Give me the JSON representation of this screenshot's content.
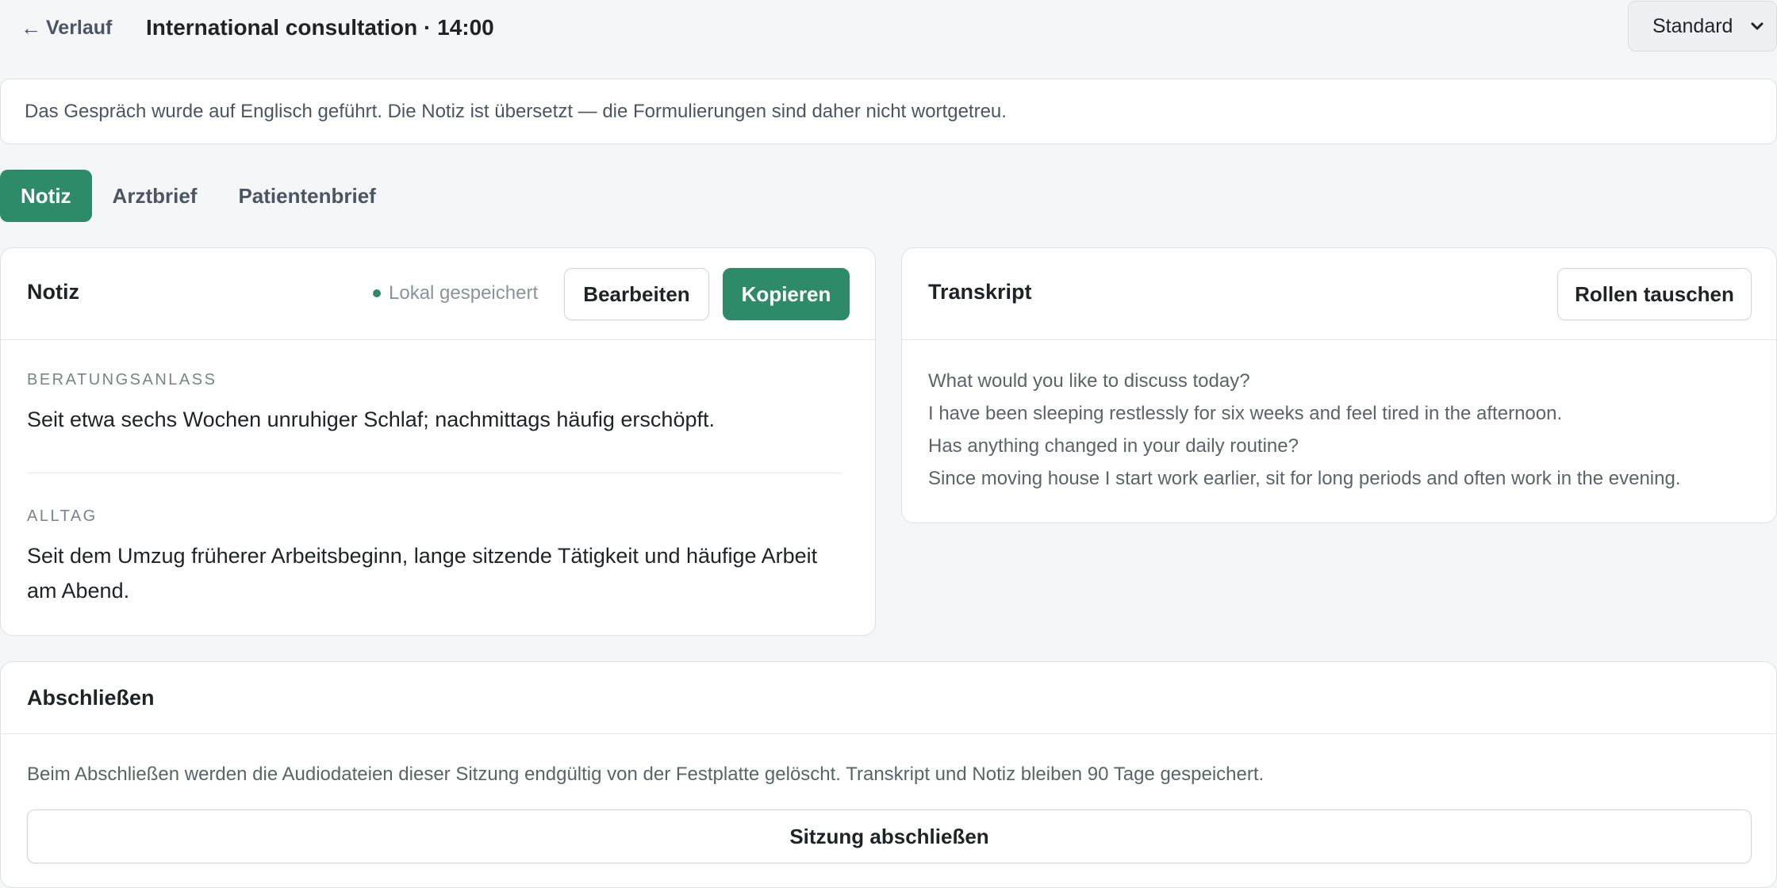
{
  "header": {
    "back_label": "Verlauf",
    "session_title": "International consultation · 14:00",
    "mode_selected": "Standard"
  },
  "banner": {
    "text": "Das Gespräch wurde auf Englisch geführt. Die Notiz ist übersetzt — die Formulierungen sind daher nicht wortgetreu."
  },
  "tabs": [
    {
      "label": "Notiz",
      "active": true
    },
    {
      "label": "Arztbrief",
      "active": false
    },
    {
      "label": "Patientenbrief",
      "active": false
    }
  ],
  "note_card": {
    "title": "Notiz",
    "saved_status": "Lokal gespeichert",
    "edit_label": "Bearbeiten",
    "copy_label": "Kopieren",
    "sections": [
      {
        "label": "BERATUNGSANLASS",
        "text": "Seit etwa sechs Wochen unruhiger Schlaf; nachmittags häufig erschöpft."
      },
      {
        "label": "ALLTAG",
        "text": "Seit dem Umzug früherer Arbeitsbeginn, lange sitzende Tätigkeit und häufige Arbeit am Abend."
      }
    ]
  },
  "transcript_card": {
    "title": "Transkript",
    "swap_roles_label": "Rollen tauschen",
    "lines": [
      "What would you like to discuss today?",
      "I have been sleeping restlessly for six weeks and feel tired in the afternoon.",
      "Has anything changed in your daily routine?",
      "Since moving house I start work earlier, sit for long periods and often work in the evening."
    ]
  },
  "finish_card": {
    "title": "Abschließen",
    "text": "Beim Abschließen werden die Audiodateien dieser Sitzung endgültig von der Festplatte gelöscht. Transkript und Notiz bleiben 90 Tage gespeichert.",
    "button_label": "Sitzung abschließen"
  },
  "colors": {
    "accent": "#2e8b6a",
    "background": "#f4f6f8",
    "card": "#ffffff",
    "border": "#dde2e7"
  },
  "icons": {
    "back": "arrow-left-icon",
    "select": "chevron-down-icon",
    "saved": "status-dot-icon"
  }
}
